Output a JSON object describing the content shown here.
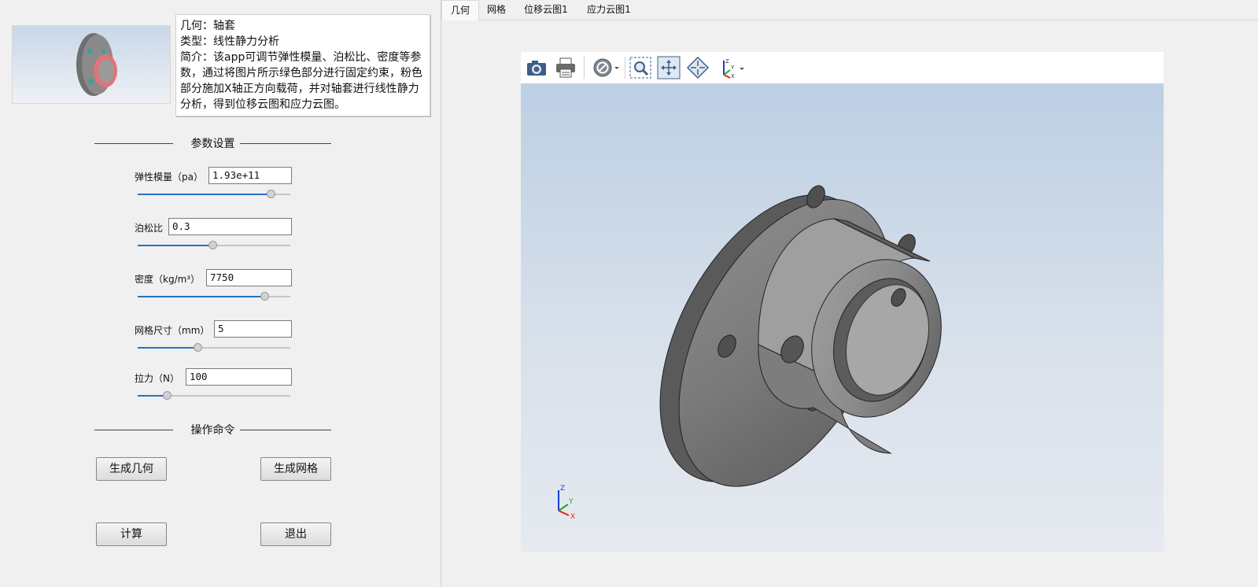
{
  "description": {
    "geometry": "几何：轴套",
    "type": "类型：线性静力分析",
    "intro": "简介：该app可调节弹性模量、泊松比、密度等参数，通过将图片所示绿色部分进行固定约束，粉色部分施加X轴正方向载荷，并对轴套进行线性静力分析，得到位移云图和应力云图。"
  },
  "params_section": "参数设置",
  "params": [
    {
      "label": "弹性模量（pa）",
      "value": "1.93e+11",
      "slider_fraction": 0.87
    },
    {
      "label": "泊松比",
      "value": "0.3",
      "slider_fraction": 0.49
    },
    {
      "label": "密度（kg/m³）",
      "value": "7750",
      "slider_fraction": 0.83
    },
    {
      "label": "网格尺寸（mm）",
      "value": "5",
      "slider_fraction": 0.39
    },
    {
      "label": "拉力（N）",
      "value": "100",
      "slider_fraction": 0.19
    }
  ],
  "commands_section": "操作命令",
  "buttons": {
    "gen_geometry": "生成几何",
    "gen_mesh": "生成网格",
    "compute": "计算",
    "exit": "退出"
  },
  "tabs": [
    {
      "label": "几何",
      "active": true
    },
    {
      "label": "网格",
      "active": false
    },
    {
      "label": "位移云图1",
      "active": false
    },
    {
      "label": "应力云图1",
      "active": false
    }
  ],
  "toolbar_icons": [
    "camera-icon",
    "print-icon",
    "hide-icon",
    "zoom-box-icon",
    "zoom-extents-icon",
    "view-fit-icon",
    "axis-orientation-icon"
  ],
  "axis_triad": {
    "x": "X",
    "y": "Y",
    "z": "Z"
  },
  "colors": {
    "accent": "#2a6fc9",
    "axis_x": "#e0201b",
    "axis_y": "#23a923",
    "axis_z": "#1b3cd6"
  }
}
